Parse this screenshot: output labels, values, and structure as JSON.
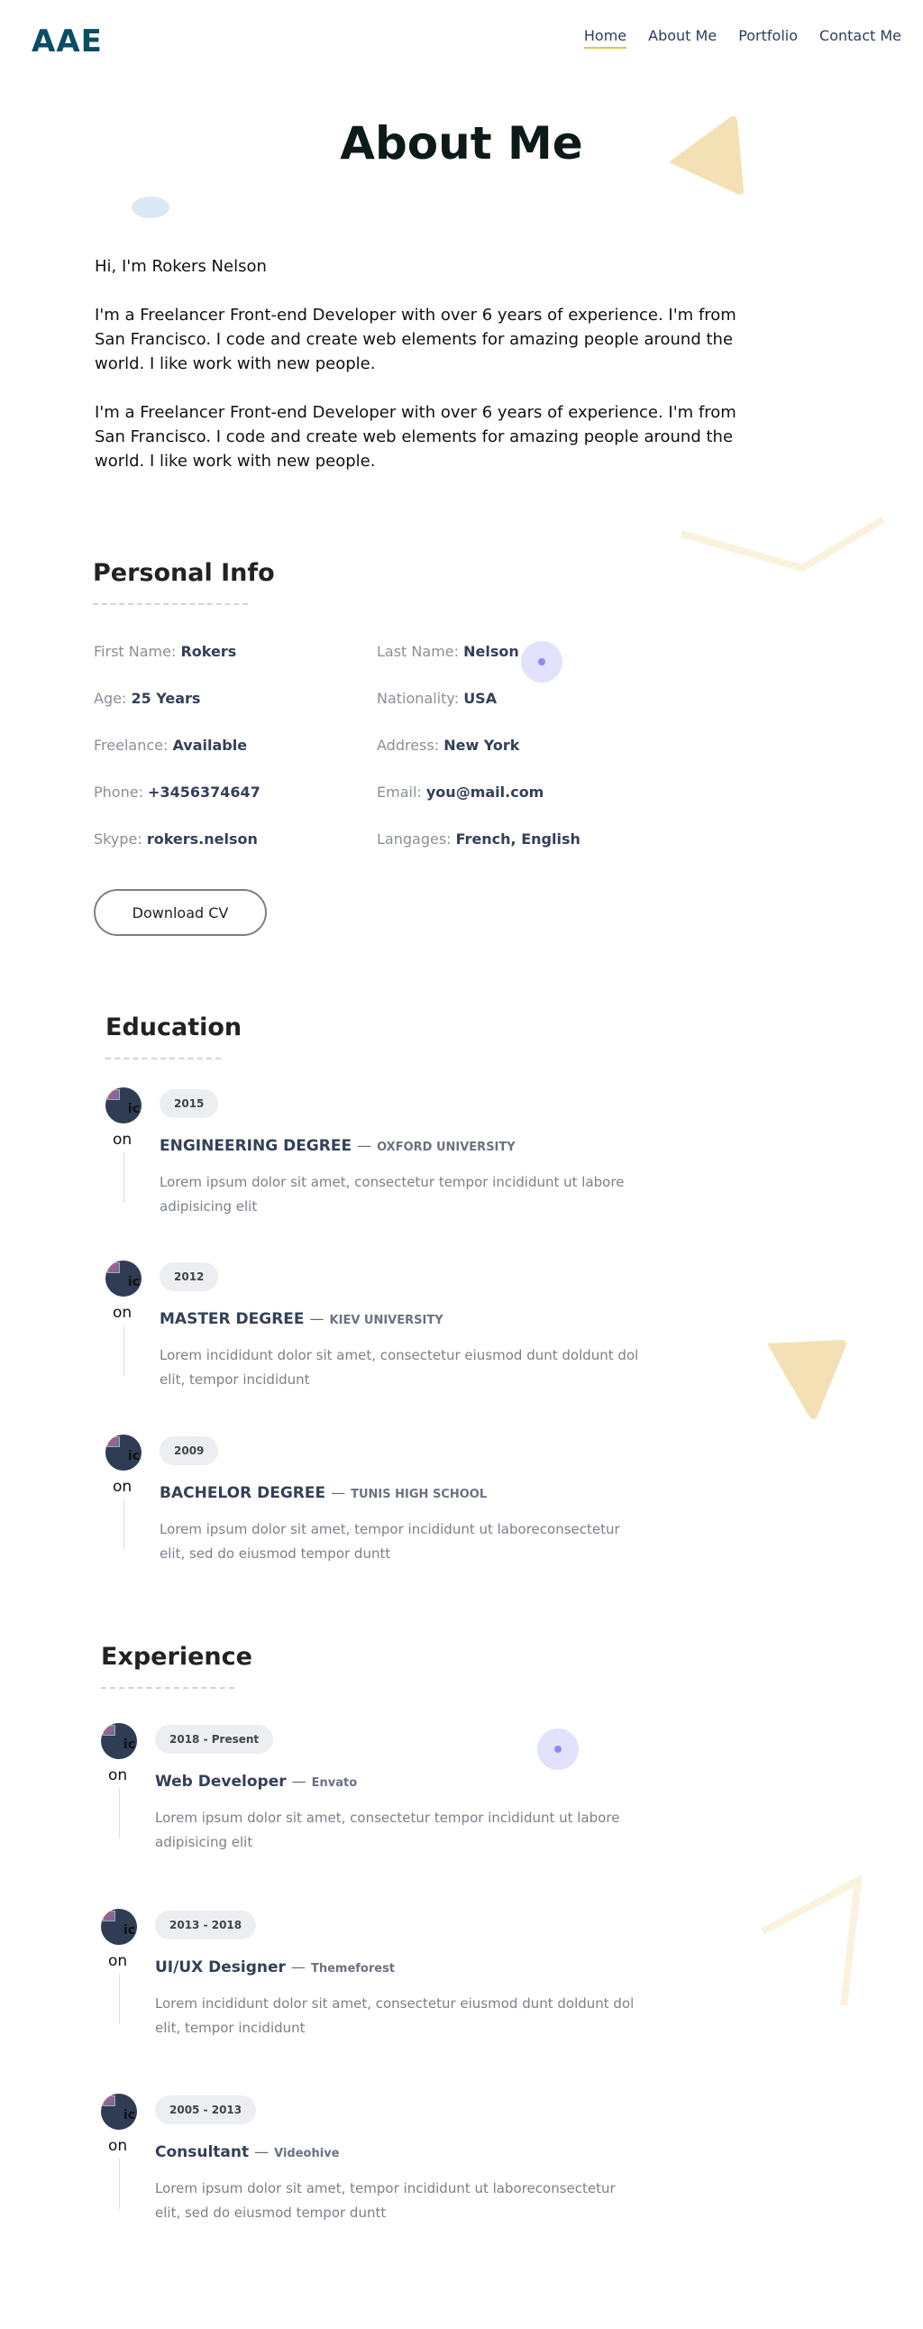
{
  "header": {
    "logo": "AAE",
    "nav": [
      "Home",
      "About Me",
      "Portfolio",
      "Contact Me"
    ]
  },
  "page_title": "About Me",
  "about": {
    "greeting": "Hi, I'm Rokers Nelson",
    "paragraphs": [
      "I'm a Freelancer Front-end Developer with over 6 years of experience. I'm from San Francisco. I code and create web elements for amazing people around the world. I like work with new people.",
      "I'm a Freelancer Front-end Developer with over 6 years of experience. I'm from San Francisco. I code and create web elements for amazing people around the world. I like work with new people."
    ]
  },
  "personal_info": {
    "title": "Personal Info",
    "items": [
      {
        "label": "First Name:",
        "value": "Rokers"
      },
      {
        "label": "Last Name:",
        "value": "Nelson"
      },
      {
        "label": "Age:",
        "value": "25 Years"
      },
      {
        "label": "Nationality:",
        "value": "USA"
      },
      {
        "label": "Freelance:",
        "value": "Available"
      },
      {
        "label": "Address:",
        "value": "New York"
      },
      {
        "label": "Phone:",
        "value": "+3456374647"
      },
      {
        "label": "Email:",
        "value": "you@mail.com"
      },
      {
        "label": "Skype:",
        "value": "rokers.nelson"
      },
      {
        "label": "Langages:",
        "value": "French, English"
      }
    ],
    "download_button": "Download CV"
  },
  "education": {
    "title": "Education",
    "items": [
      {
        "avatar_text": "ic",
        "on": "on",
        "year": "2015",
        "degree": "ENGINEERING DEGREE",
        "sep": "—",
        "school": "OXFORD UNIVERSITY",
        "desc": "Lorem ipsum dolor sit amet, consectetur tempor incididunt ut labore adipisicing elit"
      },
      {
        "avatar_text": "ic",
        "on": "on",
        "year": "2012",
        "degree": "MASTER DEGREE",
        "sep": "—",
        "school": "KIEV UNIVERSITY",
        "desc": "Lorem incididunt dolor sit amet, consectetur eiusmod dunt doldunt dol elit, tempor incididunt"
      },
      {
        "avatar_text": "ic",
        "on": "on",
        "year": "2009",
        "degree": "BACHELOR DEGREE",
        "sep": "—",
        "school": "TUNIS HIGH SCHOOL",
        "desc": "Lorem ipsum dolor sit amet, tempor incididunt ut laboreconsectetur elit, sed do eiusmod tempor duntt"
      }
    ]
  },
  "experience": {
    "title": "Experience",
    "items": [
      {
        "avatar_text": "ic",
        "on": "on",
        "period": "2018 - Present",
        "role": "Web Developer",
        "sep": "—",
        "company": "Envato",
        "desc": "Lorem ipsum dolor sit amet, consectetur tempor incididunt ut labore adipisicing elit"
      },
      {
        "avatar_text": "ic",
        "on": "on",
        "period": "2013 - 2018",
        "role": "UI/UX Designer",
        "sep": "—",
        "company": "Themeforest",
        "desc": "Lorem incididunt dolor sit amet, consectetur eiusmod dunt doldunt dol elit, tempor incididunt"
      },
      {
        "avatar_text": "ic",
        "on": "on",
        "period": "2005 - 2013",
        "role": "Consultant",
        "sep": "—",
        "company": "Videohive",
        "desc": "Lorem ipsum dolor sit amet, tempor incididunt ut laboreconsectetur elit, sed do eiusmod tempor duntt"
      }
    ]
  },
  "colors": {
    "logo": "#0a4d64",
    "nav_text": "#2d3e5c",
    "nav_active_underline": "#e8c24a",
    "deco_triangle": "#f3e1b5",
    "deco_blob": "#dbe8f5",
    "deco_circle": "#dcdcfb",
    "value_text": "#334058",
    "label_text": "#8a8f98"
  }
}
